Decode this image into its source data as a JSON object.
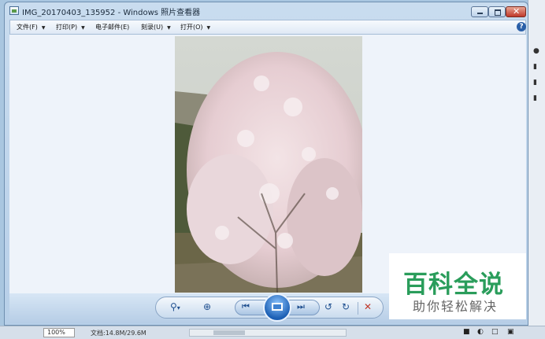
{
  "window": {
    "title": "IMG_20170403_135952 - Windows 照片查看器",
    "close_glyph": "✕"
  },
  "menu": {
    "items": [
      {
        "label": "文件(F)",
        "has_arrow": true
      },
      {
        "label": "打印(P)",
        "has_arrow": true
      },
      {
        "label": "电子邮件(E)",
        "has_arrow": false
      },
      {
        "label": "刻录(U)",
        "has_arrow": true
      },
      {
        "label": "打开(O)",
        "has_arrow": true
      }
    ],
    "arrow_glyph": "▼",
    "help_glyph": "?"
  },
  "controls": {
    "zoom_glyph": "⚲",
    "zoom_arrow": "▾",
    "fit_glyph": "⊕",
    "prev_glyph": "⏮",
    "next_glyph": "⏭",
    "rotate_ccw_glyph": "↺",
    "rotate_cw_glyph": "↻",
    "delete_glyph": "✕"
  },
  "status": {
    "zoom": "100%",
    "document": "文档:14.8M/29.6M"
  },
  "watermark": {
    "title": "百科全说",
    "subtitle": "助你轻松解决"
  },
  "colors": {
    "accent": "#1c5fb4",
    "watermark_green": "#2a9d5b",
    "delete_red": "#c0392b"
  }
}
